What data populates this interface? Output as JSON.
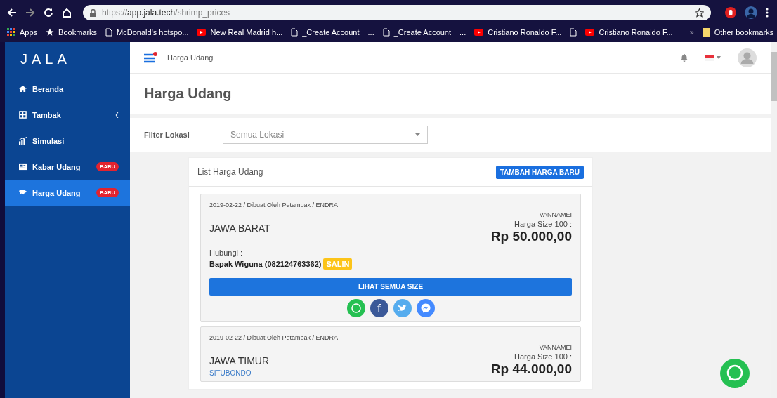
{
  "browser": {
    "url": {
      "scheme": "https://",
      "host": "app.jala.tech",
      "path": "/shrimp_prices"
    },
    "bookmarks": [
      {
        "kind": "apps",
        "label": "Apps"
      },
      {
        "kind": "star",
        "label": "Bookmarks"
      },
      {
        "kind": "page",
        "label": "McDonald's hotspo..."
      },
      {
        "kind": "youtube",
        "label": "New Real Madrid h..."
      },
      {
        "kind": "page",
        "label": "_Create Account"
      },
      {
        "kind": "text",
        "label": "..."
      },
      {
        "kind": "page",
        "label": "_Create Account"
      },
      {
        "kind": "text",
        "label": "..."
      },
      {
        "kind": "youtube",
        "label": "Cristiano Ronaldo F..."
      },
      {
        "kind": "page"
      },
      {
        "kind": "youtube",
        "label": "Cristiano Ronaldo F..."
      }
    ],
    "overflow": "»",
    "other_bookmarks": "Other bookmarks"
  },
  "sidebar": {
    "logo": "JALA",
    "items": [
      {
        "kind": "home",
        "label": "Beranda",
        "selected": false
      },
      {
        "kind": "grid",
        "label": "Tambak",
        "selected": false,
        "expandable": true
      },
      {
        "kind": "chart",
        "label": "Simulasi",
        "selected": false
      },
      {
        "kind": "news",
        "label": "Kabar Udang",
        "badge": "BARU",
        "selected": false
      },
      {
        "kind": "shrimp",
        "label": "Harga Udang",
        "badge": "BARU",
        "selected": true
      }
    ]
  },
  "header": {
    "breadcrumb": "Harga Udang"
  },
  "page_title": "Harga Udang",
  "filter": {
    "label": "Filter Lokasi",
    "value": "Semua Lokasi"
  },
  "list": {
    "title": "List Harga Udang",
    "add_button": "TAMBAH HARGA BARU",
    "entries": [
      {
        "meta": "2019-02-22 / Dibuat Oleh Petambak / ENDRA",
        "region": "JAWA BARAT",
        "species": "VANNAMEI",
        "size_label": "Harga Size 100 :",
        "price": "Rp 50.000,00",
        "contact_label": "Hubungi :",
        "contact": "Bapak Wiguna (082124763362)",
        "copy_button": "SALIN",
        "view_button": "LIHAT SEMUA SIZE"
      },
      {
        "meta": "2019-02-22 / Dibuat Oleh Petambak / ENDRA",
        "region": "JAWA TIMUR",
        "subregion": "SITUBONDO",
        "species": "VANNAMEI",
        "size_label": "Harga Size 100 :",
        "price": "Rp 44.000,00"
      }
    ]
  }
}
